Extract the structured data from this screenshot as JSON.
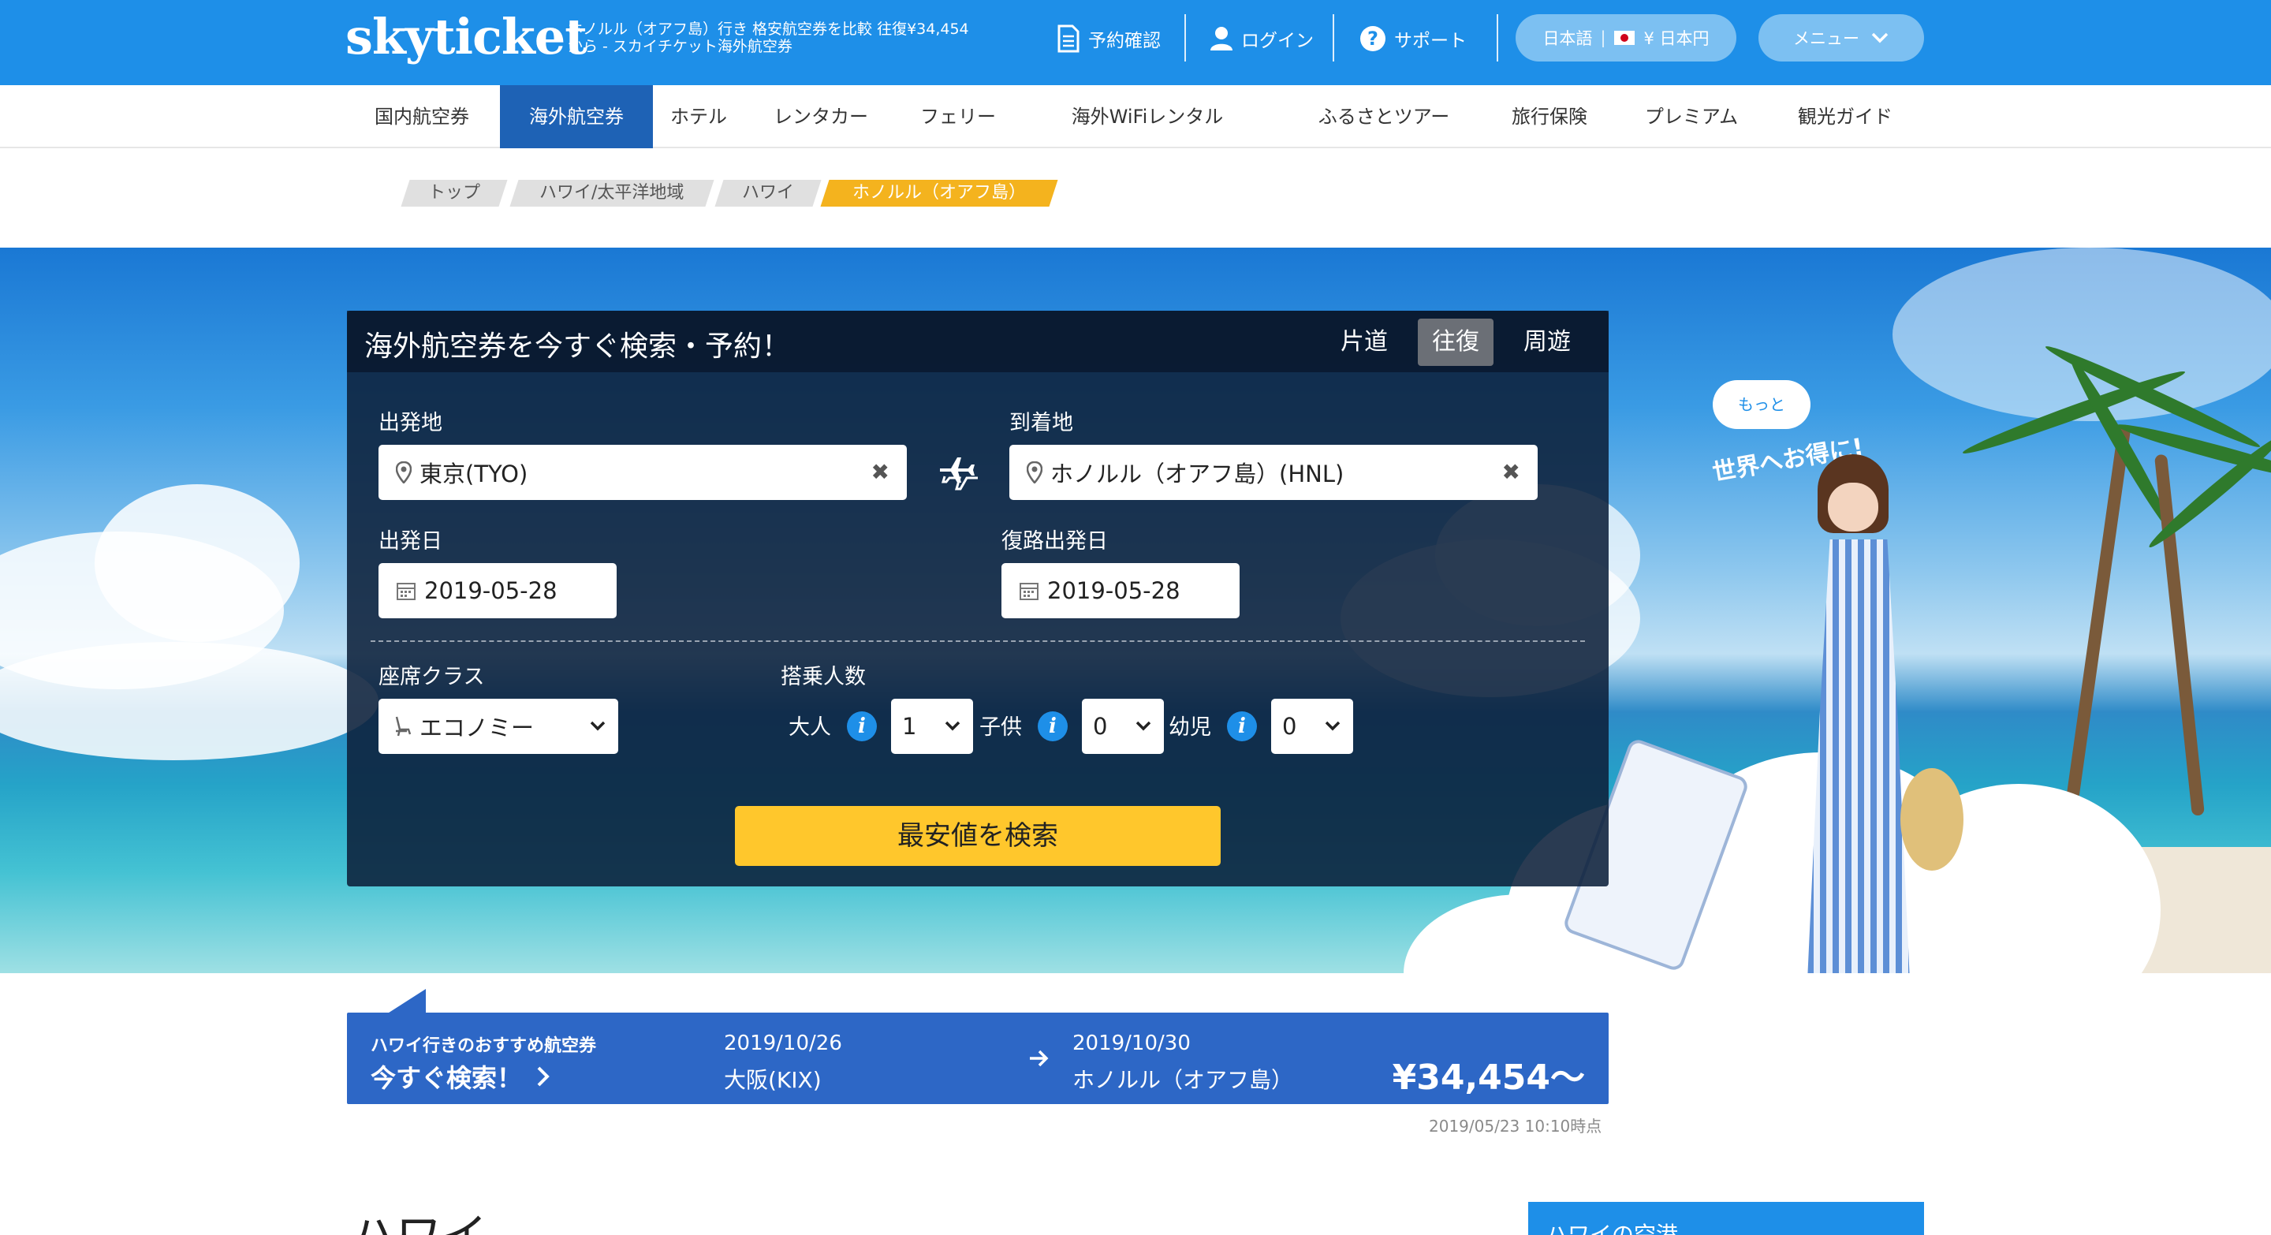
{
  "header": {
    "logo": "skyticket",
    "tagline": "ホノルル（オアフ島）行き 格安航空券を比較 往復¥34,454から - スカイチケット海外航空券",
    "nav": {
      "reservation": "予約確認",
      "login": "ログイン",
      "support": "サポート",
      "language": "日本語",
      "currency": "¥ 日本円",
      "menu": "メニュー"
    }
  },
  "categories": [
    "国内航空券",
    "海外航空券",
    "ホテル",
    "レンタカー",
    "フェリー",
    "海外WiFiレンタル",
    "ふるさとツアー",
    "旅行保険",
    "プレミアム",
    "観光ガイド"
  ],
  "breadcrumb": [
    "トップ",
    "ハワイ/太平洋地域",
    "ハワイ",
    "ホノルル（オアフ島）"
  ],
  "search": {
    "title": "海外航空券を今すぐ検索・予約！",
    "trip_types": [
      "片道",
      "往復",
      "周遊"
    ],
    "origin_label": "出発地",
    "origin_value": "東京(TYO)",
    "destination_label": "到着地",
    "destination_value": "ホノルル（オアフ島）(HNL)",
    "depart_label": "出発日",
    "depart_value": "2019-05-28",
    "return_label": "復路出発日",
    "return_value": "2019-05-28",
    "class_label": "座席クラス",
    "class_value": "エコノミー",
    "pax_label": "搭乗人数",
    "adult_label": "大人",
    "adult_value": "1",
    "child_label": "子供",
    "child_value": "0",
    "infant_label": "幼児",
    "infant_value": "0",
    "button": "最安値を検索"
  },
  "promo": {
    "bubble": "もっと",
    "slogan": "世界へお得に!"
  },
  "recommend": {
    "heading": "ハワイ行きのおすすめ航空券",
    "cta": "今すぐ検索！",
    "depart_date": "2019/10/26",
    "depart_place": "大阪(KIX)",
    "arrive_date": "2019/10/30",
    "arrive_place": "ホノルル（オアフ島）",
    "price": "¥34,454〜",
    "timestamp": "2019/05/23 10:10時点"
  },
  "section": {
    "title": "ハワイ",
    "side_title": "ハワイの空港"
  },
  "colors": {
    "header_blue": "#1e8fe8",
    "active_tab": "#1e62b5",
    "search_button": "#ffc72c",
    "recommend_bar": "#2d67c6",
    "breadcrumb_current": "#f4b31e"
  }
}
